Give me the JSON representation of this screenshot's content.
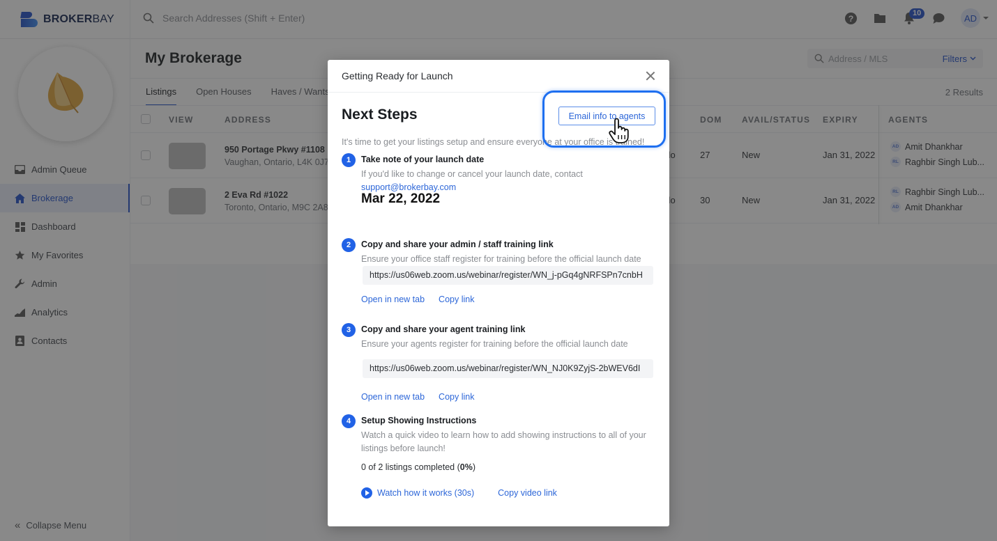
{
  "brand": {
    "name_bold": "BROKER",
    "name_light": "BAY",
    "accent": "#1f4fc9"
  },
  "topbar": {
    "search_placeholder": "Search Addresses (Shift + Enter)",
    "icons": [
      "help-icon",
      "folder-icon",
      "bell-icon",
      "chat-icon"
    ],
    "notification_count": "10",
    "user_initials": "AD"
  },
  "sidebar": {
    "items": [
      {
        "label": "Admin Queue",
        "icon": "inbox-icon",
        "active": false
      },
      {
        "label": "Brokerage",
        "icon": "home-icon",
        "active": true
      },
      {
        "label": "Dashboard",
        "icon": "dashboard-icon",
        "active": false
      },
      {
        "label": "My Favorites",
        "icon": "star-icon",
        "active": false
      },
      {
        "label": "Admin",
        "icon": "wrench-icon",
        "active": false
      },
      {
        "label": "Analytics",
        "icon": "analytics-icon",
        "active": false
      },
      {
        "label": "Contacts",
        "icon": "contacts-icon",
        "active": false
      }
    ],
    "collapse_label": "Collapse Menu"
  },
  "main": {
    "title": "My Brokerage",
    "tabs": [
      {
        "label": "Listings",
        "active": true
      },
      {
        "label": "Open Houses",
        "active": false
      },
      {
        "label": "Haves / Wants",
        "active": false
      }
    ],
    "address_search_placeholder": "Address / MLS",
    "filters_label": "Filters",
    "results_count": "2 Results",
    "table": {
      "columns": [
        "VIEW",
        "ADDRESS",
        "DOM",
        "AVAIL/STATUS",
        "EXPIRY",
        "AGENTS"
      ],
      "rows": [
        {
          "address_line1": "950 Portage Pkwy #1108",
          "address_line2": "Vaughan, Ontario, L4K 0J7",
          "type_fragment": "ndo",
          "dom": "27",
          "status": "New",
          "expiry": "Jan 31, 2022",
          "agents": [
            {
              "initials": "AD",
              "name": "Amit Dhankhar"
            },
            {
              "initials": "RL",
              "name": "Raghbir Singh Lub..."
            }
          ]
        },
        {
          "address_line1": "2 Eva Rd #1022",
          "address_line2": "Toronto, Ontario, M9C 2A8",
          "type_fragment": "ndo",
          "dom": "30",
          "status": "New",
          "expiry": "Jan 31, 2022",
          "agents": [
            {
              "initials": "RL",
              "name": "Raghbir Singh Lub..."
            },
            {
              "initials": "AD",
              "name": "Amit Dhankhar"
            }
          ]
        }
      ]
    }
  },
  "modal": {
    "title": "Getting Ready for Launch",
    "heading": "Next Steps",
    "email_button": "Email info to agents",
    "intro": "It's time to get your listings setup and ensure everyone at your office is trained!",
    "steps": [
      {
        "number": "1",
        "title": "Take note of your launch date",
        "description": "If you'd like to change or cancel your launch date, contact",
        "support_email": "support@brokerbay.com",
        "launch_date": "Mar 22, 2022"
      },
      {
        "number": "2",
        "title": "Copy and share your admin / staff training link",
        "description": "Ensure your office staff register for training before the official launch date",
        "url": "https://us06web.zoom.us/webinar/register/WN_j-pGq4gNRFSPn7cnbH",
        "open_label": "Open in new tab",
        "copy_label": "Copy link"
      },
      {
        "number": "3",
        "title": "Copy and share your agent training link",
        "description": "Ensure your agents register for training before the official launch date",
        "url": "https://us06web.zoom.us/webinar/register/WN_NJ0K9ZyjS-2bWEV6dI",
        "open_label": "Open in new tab",
        "copy_label": "Copy link"
      },
      {
        "number": "4",
        "title": "Setup Showing Instructions",
        "description": "Watch a quick video to learn how to add showing instructions to all of your listings before launch!",
        "progress_prefix": "0 of 2 listings completed (",
        "progress_percent": "0%",
        "progress_suffix": ")",
        "watch_label": "Watch how it works (30s)",
        "copy_video_label": "Copy video link"
      }
    ]
  }
}
